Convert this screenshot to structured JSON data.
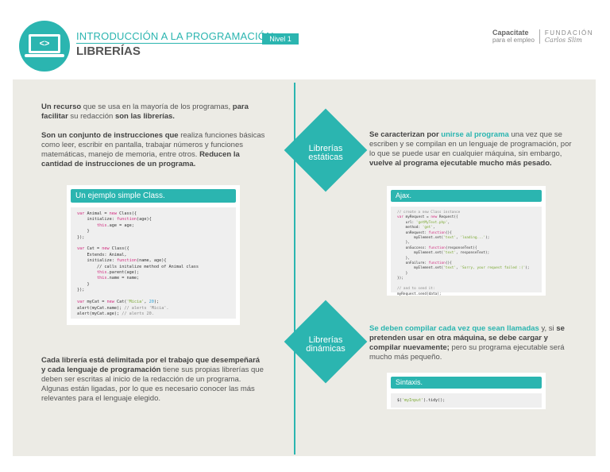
{
  "header": {
    "title": "INTRODUCCIÓN A LA PROGRAMACIÓN",
    "subtitle": "LIBRERÍAS",
    "level": "Nivel 1",
    "icon_text": "<>",
    "brand1": "Capacitate",
    "brand1_sub": "para el empleo",
    "brand2": "FUNDACIÓN",
    "brand2_sub": "Carlos Slim"
  },
  "left": {
    "p1": [
      [
        "Un recurso",
        "b"
      ],
      [
        " que se usa en la mayoría de los programas, ",
        ""
      ],
      [
        "para facilitar",
        "b"
      ],
      [
        " su redacción ",
        ""
      ],
      [
        "son las librerías.",
        "b"
      ]
    ],
    "p2": [
      [
        "Son un conjunto de instrucciones que",
        "b"
      ],
      [
        " realiza funciones básicas como leer, escribir en pantalla, trabajar números y funciones matemáticas, manejo de memoria, entre otros. ",
        ""
      ],
      [
        "Reducen la cantidad de instrucciones de un programa.",
        "b"
      ]
    ],
    "p3": [
      [
        "Cada librería está delimitada por el trabajo que desempeñará y cada lenguaje de programación",
        "b"
      ],
      [
        " tiene sus propias librerías que deben ser escritas al inicio de la redacción de un programa. Algunas están ligadas, por lo que es necesario conocer las más relevantes para el lenguaje elegido.",
        ""
      ]
    ]
  },
  "class_card": {
    "title": "Un ejemplo simple Class.",
    "code": [
      [
        [
          "var",
          "k"
        ],
        [
          " Animal = ",
          ""
        ],
        [
          "new",
          "k"
        ],
        [
          " Class({",
          ""
        ]
      ],
      [
        [
          "    initialize: ",
          ""
        ],
        [
          "function",
          "k"
        ],
        [
          "(age){",
          ""
        ]
      ],
      [
        [
          "        ",
          ""
        ],
        [
          "this",
          "k"
        ],
        [
          ".age = age;",
          ""
        ]
      ],
      [
        [
          "    }",
          ""
        ]
      ],
      [
        [
          "});",
          ""
        ]
      ],
      [
        [
          "",
          ""
        ]
      ],
      [
        [
          "var",
          "k"
        ],
        [
          " Cat = ",
          ""
        ],
        [
          "new",
          "k"
        ],
        [
          " Class({",
          ""
        ]
      ],
      [
        [
          "    Extends: Animal,",
          ""
        ]
      ],
      [
        [
          "    initialize: ",
          ""
        ],
        [
          "function",
          "k"
        ],
        [
          "(name, age){",
          ""
        ]
      ],
      [
        [
          "        // calls initalize method of Animal class",
          ""
        ]
      ],
      [
        [
          "        ",
          ""
        ],
        [
          "this",
          "k"
        ],
        [
          ".parent(age);",
          ""
        ]
      ],
      [
        [
          "        ",
          ""
        ],
        [
          "this",
          "k"
        ],
        [
          ".name = name;",
          ""
        ]
      ],
      [
        [
          "    }",
          ""
        ]
      ],
      [
        [
          "});",
          ""
        ]
      ],
      [
        [
          "",
          ""
        ]
      ],
      [
        [
          "var",
          "k"
        ],
        [
          " myCat = ",
          ""
        ],
        [
          "new",
          "k"
        ],
        [
          " Cat(",
          ""
        ],
        [
          "'Micia'",
          "s"
        ],
        [
          ", ",
          ""
        ],
        [
          "20",
          "n"
        ],
        [
          ");",
          ""
        ]
      ],
      [
        [
          "alert(myCat.name); ",
          ""
        ],
        [
          "// alerts 'Micia'.",
          "c"
        ]
      ],
      [
        [
          "alert(myCat.age); ",
          ""
        ],
        [
          "// alerts 20.",
          "c"
        ]
      ]
    ]
  },
  "static": {
    "label": "Librerías estáticas",
    "text": [
      [
        "Se caracterizan por ",
        "b"
      ],
      [
        "unirse al programa",
        "hl"
      ],
      [
        " una vez que se escriben y se compilan en un lenguaje de programación, por lo que se puede usar en cualquier máquina, sin embargo, ",
        ""
      ],
      [
        "vuelve al programa ejecutable mucho más pesado.",
        "b"
      ]
    ]
  },
  "ajax_card": {
    "title": "Ajax.",
    "code": [
      [
        [
          "// create a new Class instance",
          "c"
        ]
      ],
      [
        [
          "var",
          "k"
        ],
        [
          " myRequest = ",
          ""
        ],
        [
          "new",
          "k"
        ],
        [
          " Request({",
          ""
        ]
      ],
      [
        [
          "    url: ",
          ""
        ],
        [
          "'getMyText.php'",
          "s"
        ],
        [
          ",",
          ""
        ]
      ],
      [
        [
          "    method: ",
          ""
        ],
        [
          "'get'",
          "s"
        ],
        [
          ",",
          ""
        ]
      ],
      [
        [
          "    onRequest: ",
          ""
        ],
        [
          "function",
          "k"
        ],
        [
          "(){",
          ""
        ]
      ],
      [
        [
          "        myElement.set(",
          ""
        ],
        [
          "'text'",
          "s"
        ],
        [
          ", ",
          ""
        ],
        [
          "'loading...'",
          "s"
        ],
        [
          ");",
          ""
        ]
      ],
      [
        [
          "    },",
          ""
        ]
      ],
      [
        [
          "    onSuccess: ",
          ""
        ],
        [
          "function",
          "k"
        ],
        [
          "(responseText){",
          ""
        ]
      ],
      [
        [
          "        myElement.set(",
          ""
        ],
        [
          "'text'",
          "s"
        ],
        [
          ", responseText);",
          ""
        ]
      ],
      [
        [
          "    },",
          ""
        ]
      ],
      [
        [
          "    onFailure: ",
          ""
        ],
        [
          "function",
          "k"
        ],
        [
          "(){",
          ""
        ]
      ],
      [
        [
          "        myElement.set(",
          ""
        ],
        [
          "'text'",
          "s"
        ],
        [
          ", ",
          ""
        ],
        [
          "'Sorry, your request failed :('",
          "s"
        ],
        [
          ");",
          ""
        ]
      ],
      [
        [
          "    }",
          ""
        ]
      ],
      [
        [
          "});",
          ""
        ]
      ],
      [
        [
          "",
          ""
        ]
      ],
      [
        [
          "// and to send it:",
          "c"
        ]
      ],
      [
        [
          "myRequest.send(data);",
          ""
        ]
      ]
    ]
  },
  "dynamic": {
    "label": "Librerías dinámicas",
    "text": [
      [
        "Se deben compilar cada vez que sean llamadas",
        "hl"
      ],
      [
        " y, si ",
        ""
      ],
      [
        "se pretenden usar en otra máquina, se debe cargar y compilar nuevamente;",
        "b"
      ],
      [
        " pero su programa ejecutable será mucho más pequeño.",
        ""
      ]
    ]
  },
  "syntax_card": {
    "title": "Sintaxis.",
    "code": [
      [
        [
          "$(",
          ""
        ],
        [
          "'myInput'",
          "s"
        ],
        [
          ").tidy();",
          ""
        ]
      ]
    ]
  }
}
